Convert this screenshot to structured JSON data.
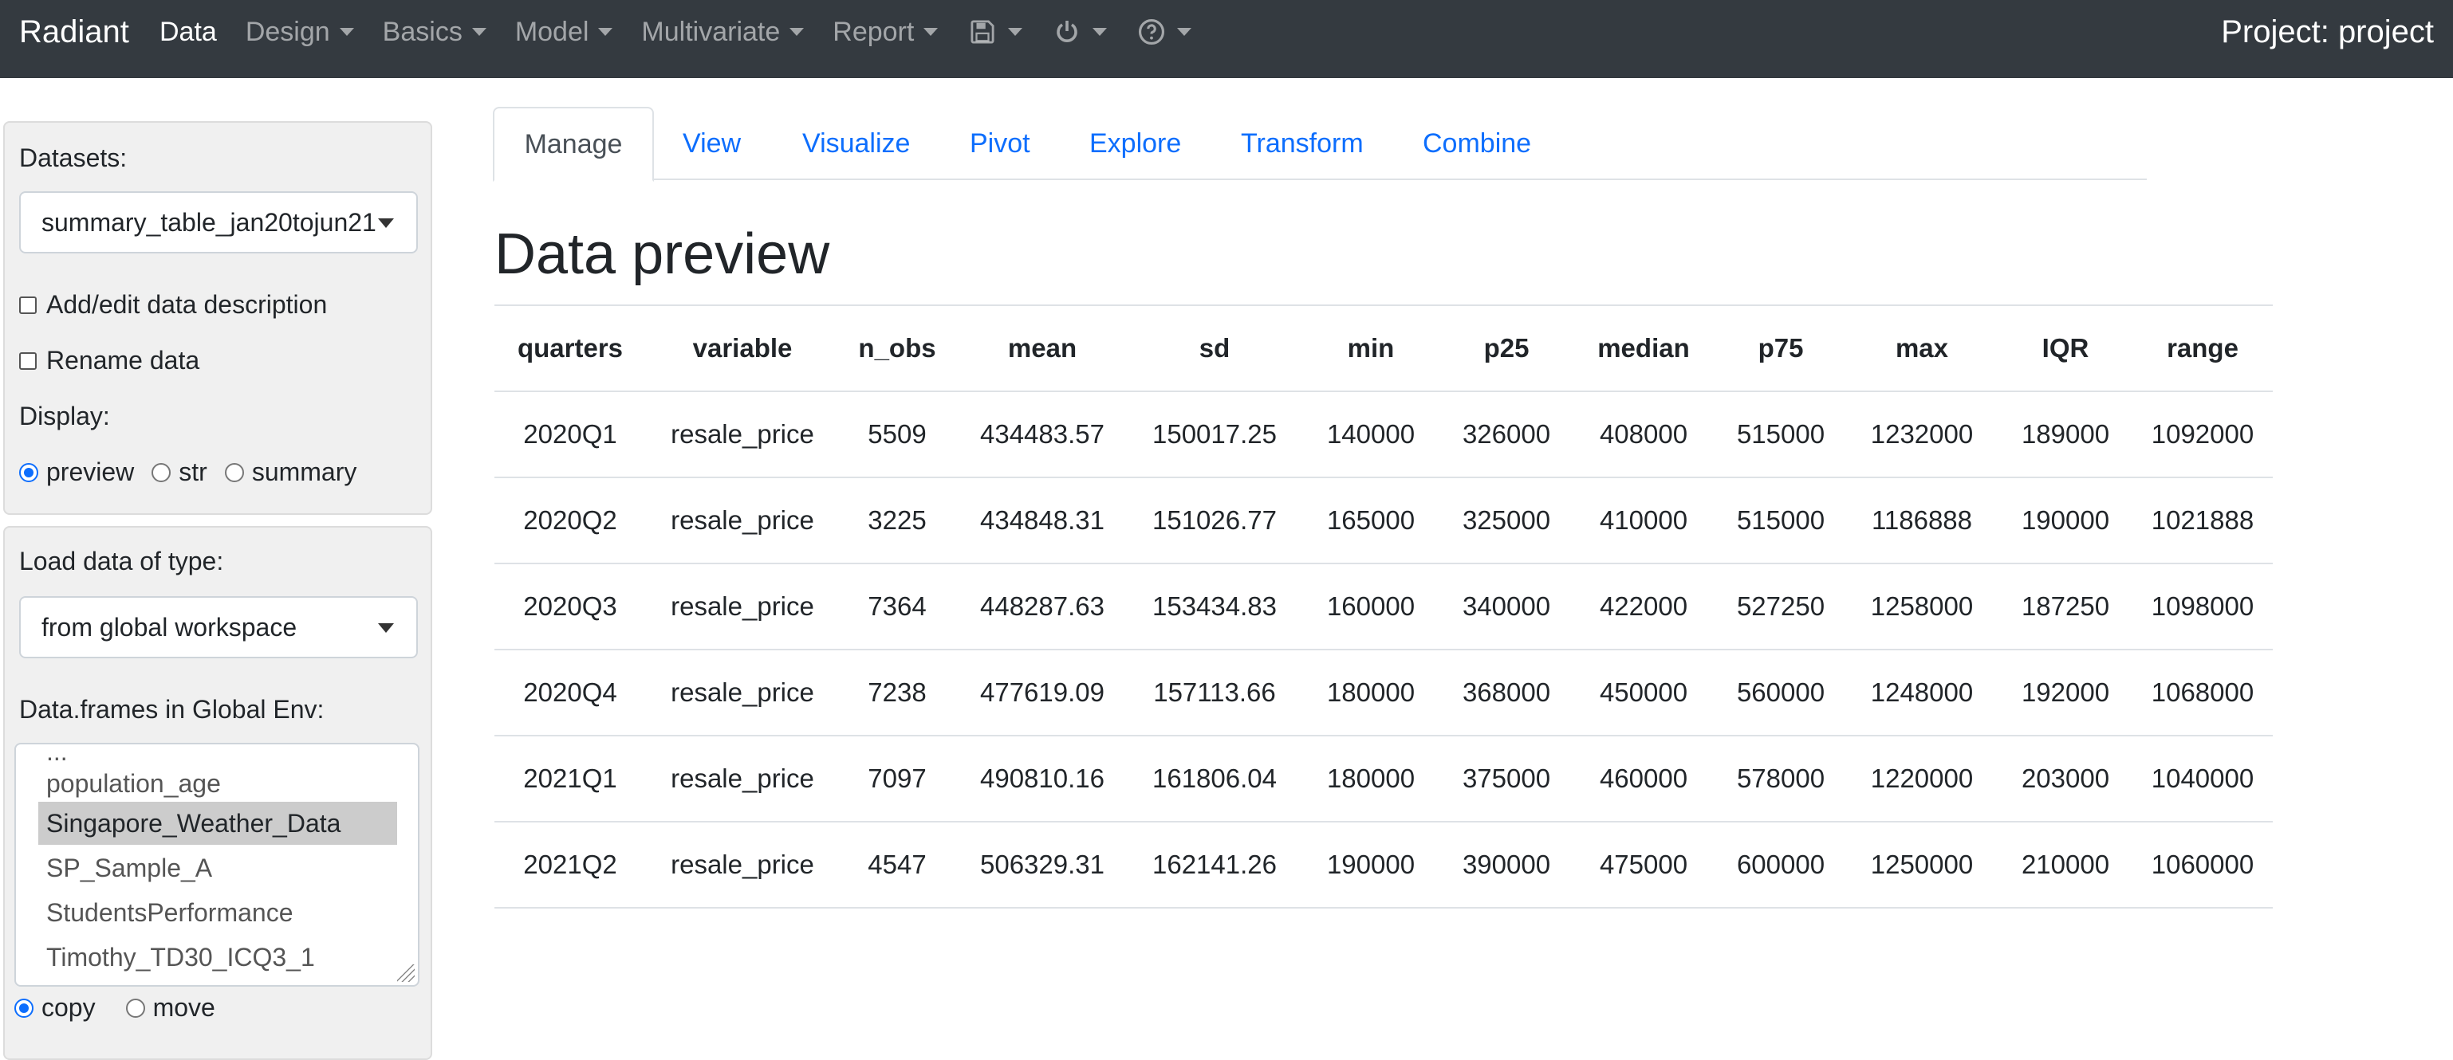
{
  "navbar": {
    "brand": "Radiant",
    "items": [
      {
        "label": "Data",
        "active": true,
        "caret": false
      },
      {
        "label": "Design",
        "caret": true
      },
      {
        "label": "Basics",
        "caret": true
      },
      {
        "label": "Model",
        "caret": true
      },
      {
        "label": "Multivariate",
        "caret": true
      },
      {
        "label": "Report",
        "caret": true
      }
    ],
    "icons": [
      "save-icon",
      "power-icon",
      "help-icon"
    ],
    "project": "Project: project"
  },
  "sidebar": {
    "datasets_label": "Datasets:",
    "dataset_selected": "summary_table_jan20tojun21",
    "add_edit_description": "Add/edit data description",
    "rename_data": "Rename data",
    "display_label": "Display:",
    "display_options": [
      "preview",
      "str",
      "summary"
    ],
    "display_selected": "preview",
    "load_type_label": "Load data of type:",
    "load_type_selected": "from global workspace",
    "dataframes_label": "Data.frames in Global Env:",
    "dataframes": [
      "population_age",
      "Singapore_Weather_Data",
      "SP_Sample_A",
      "StudentsPerformance",
      "Timothy_TD30_ICQ3_1"
    ],
    "dataframes_selected": "Singapore_Weather_Data",
    "copy_move_options": [
      "copy",
      "move"
    ],
    "copy_move_selected": "copy"
  },
  "tabs": [
    "Manage",
    "View",
    "Visualize",
    "Pivot",
    "Explore",
    "Transform",
    "Combine"
  ],
  "active_tab": "Manage",
  "main": {
    "title": "Data preview",
    "table": {
      "columns": [
        "quarters",
        "variable",
        "n_obs",
        "mean",
        "sd",
        "min",
        "p25",
        "median",
        "p75",
        "max",
        "IQR",
        "range"
      ],
      "rows": [
        [
          "2020Q1",
          "resale_price",
          "5509",
          "434483.57",
          "150017.25",
          "140000",
          "326000",
          "408000",
          "515000",
          "1232000",
          "189000",
          "1092000"
        ],
        [
          "2020Q2",
          "resale_price",
          "3225",
          "434848.31",
          "151026.77",
          "165000",
          "325000",
          "410000",
          "515000",
          "1186888",
          "190000",
          "1021888"
        ],
        [
          "2020Q3",
          "resale_price",
          "7364",
          "448287.63",
          "153434.83",
          "160000",
          "340000",
          "422000",
          "527250",
          "1258000",
          "187250",
          "1098000"
        ],
        [
          "2020Q4",
          "resale_price",
          "7238",
          "477619.09",
          "157113.66",
          "180000",
          "368000",
          "450000",
          "560000",
          "1248000",
          "192000",
          "1068000"
        ],
        [
          "2021Q1",
          "resale_price",
          "7097",
          "490810.16",
          "161806.04",
          "180000",
          "375000",
          "460000",
          "578000",
          "1220000",
          "203000",
          "1040000"
        ],
        [
          "2021Q2",
          "resale_price",
          "4547",
          "506329.31",
          "162141.26",
          "190000",
          "390000",
          "475000",
          "600000",
          "1250000",
          "210000",
          "1060000"
        ]
      ]
    }
  },
  "colors": {
    "navbar": "#343a40",
    "link": "#0d6efd",
    "sidebar": "#f0f0f0"
  }
}
